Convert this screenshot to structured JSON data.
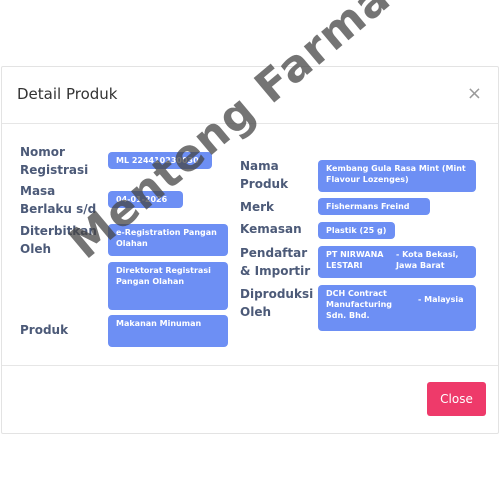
{
  "modal": {
    "title": "Detail Produk",
    "close_icon": "×",
    "close_button": "Close"
  },
  "left": {
    "nomor_label": "Nomor Registrasi",
    "nomor_value": "ML 224410230030",
    "masa_label": "Masa Berlaku s/d",
    "masa_value": "04-01-2026",
    "diterbitkan_label": "Diterbitkan Oleh",
    "diterbitkan_value1": "e-Registration Pangan Olahan",
    "diterbitkan_value2": "Direktorat Registrasi Pangan Olahan",
    "produk_label": "Produk",
    "produk_value": "Makanan Minuman"
  },
  "right": {
    "nama_label": "Nama Produk",
    "nama_value": "Kembang Gula Rasa Mint (Mint Flavour Lozenges)",
    "merk_label": "Merk",
    "merk_value": "Fishermans Freind",
    "kemasan_label": "Kemasan",
    "kemasan_value": "Plastik (25 g)",
    "pendaftar_label": "Pendaftar & Importir",
    "pendaftar_value_a": "PT NIRWANA LESTARI",
    "pendaftar_value_b": "- Kota Bekasi, Jawa Barat",
    "diproduksi_label": "Diproduksi Oleh",
    "diproduksi_value_a": "DCH Contract Manufacturing Sdn. Bhd.",
    "diproduksi_value_b": "- Malaysia"
  },
  "watermark": "Menteng Farma",
  "colors": {
    "badge": "#6d8ff4",
    "close_button": "#ee3a6a",
    "label": "#4c5a78"
  }
}
